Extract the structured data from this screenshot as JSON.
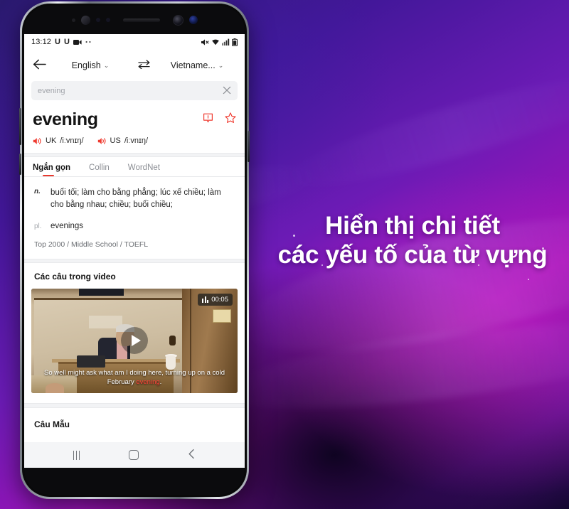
{
  "promo": {
    "line1": "Hiển thị chi tiết",
    "line2": "các yếu tố của từ vựng"
  },
  "phone": {
    "statusbar": {
      "time": "13:12",
      "app_icon_1": "U",
      "app_icon_2": "U",
      "video_icon": "video-camera-icon",
      "more_icon": "more-dots-icon",
      "mute_icon": "mute-icon",
      "wifi_icon": "wifi-icon",
      "signal_icon": "signal-bars-icon",
      "battery_icon": "battery-icon"
    },
    "langbar": {
      "back_icon": "back-arrow-icon",
      "source_lang": "English",
      "swap_icon": "swap-languages-icon",
      "target_lang": "Vietname...",
      "chevron": "⌄"
    },
    "search": {
      "value": "evening",
      "placeholder": "evening",
      "clear_icon": "clear-x-icon"
    },
    "word": {
      "headword": "evening",
      "report_icon": "report-icon",
      "star_icon": "star-icon",
      "pronunciations": [
        {
          "region": "UK",
          "ipa": "/iːvnɪŋ/",
          "speaker_icon": "speaker-icon"
        },
        {
          "region": "US",
          "ipa": "/iːvnɪŋ/",
          "speaker_icon": "speaker-icon"
        }
      ]
    },
    "tabs": [
      {
        "label": "Ngắn gọn",
        "active": true
      },
      {
        "label": "Collin",
        "active": false
      },
      {
        "label": "WordNet",
        "active": false
      }
    ],
    "definition": {
      "pos": "n.",
      "text": "buổi tối; làm cho bằng phẳng; lúc xế chiều; làm cho bằng nhau; chiều; buổi chiều;",
      "plural_label": "pl.",
      "plural_value": "evenings",
      "tags": "Top 2000 / Middle School / TOEFL"
    },
    "video_section": {
      "title": "Các câu trong video",
      "duration": "00:05",
      "waveform_icon": "waveform-icon",
      "play_icon": "play-icon",
      "subtitle_before": "So well might ask what am I doing here, turning up on a cold February ",
      "subtitle_highlight": "evening",
      "subtitle_after": "."
    },
    "examples_section": {
      "title": "Câu Mẫu"
    },
    "navbar": {
      "recents_icon": "recents-icon",
      "home_icon": "home-icon",
      "back_icon": "nav-back-icon"
    }
  },
  "colors": {
    "accent_red": "#e8392e",
    "highlight_red": "#ff4338",
    "bg_purple": "#6b1bb5",
    "bg_magenta": "#a312b8"
  }
}
